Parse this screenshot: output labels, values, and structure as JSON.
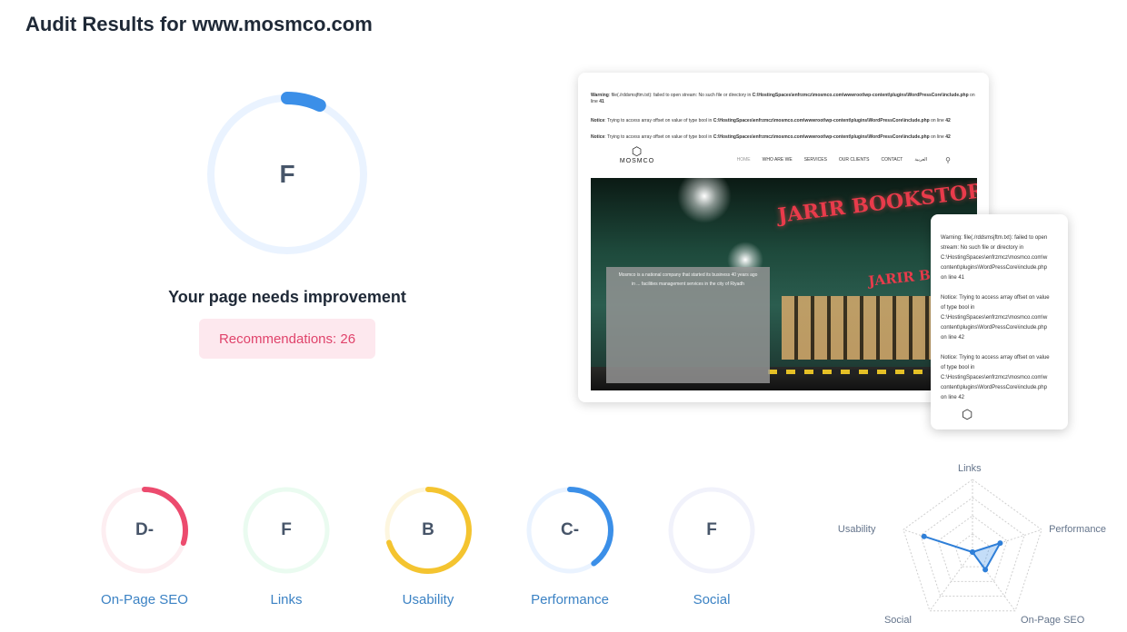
{
  "page": {
    "title": "Audit Results for www.mosmco.com"
  },
  "overall": {
    "grade": "F",
    "score_fraction": 0.07,
    "summary": "Your page needs improvement",
    "recommendations": "Recommendations: 26",
    "ring_color": "#3b8fe8",
    "ring_track": "#eaf3ff"
  },
  "desktop_preview": {
    "warnings": [
      {
        "label": "Warning",
        "text": ": file(./rddsmsjftm.txt): failed to open stream: No such file or directory in ",
        "path": "C:\\HostingSpaces\\enfrzmcz\\mosmco.com\\wwwroot\\wp-content\\plugins\\WordPressCore\\include.php",
        "suffix": " on line ",
        "line": "41"
      },
      {
        "label": "Notice",
        "text": ": Trying to access array offset on value of type bool in ",
        "path": "C:\\HostingSpaces\\enfrzmcz\\mosmco.com\\wwwroot\\wp-content\\plugins\\WordPressCore\\include.php",
        "suffix": " on line ",
        "line": "42"
      },
      {
        "label": "Notice",
        "text": ": Trying to access array offset on value of type bool in ",
        "path": "C:\\HostingSpaces\\enfrzmcz\\mosmco.com\\wwwroot\\wp-content\\plugins\\WordPressCore\\include.php",
        "suffix": " on line ",
        "line": "42"
      }
    ],
    "logo_text": "MOSMCO",
    "nav": [
      "HOME",
      "WHO ARE WE",
      "SERVICES",
      "OUR CLIENTS",
      "CONTACT",
      "العربية"
    ],
    "hero_sign": "JARIR BOOKSTORE",
    "hero_text": "Mosmco is a national company that started its business 40 years ago in ... facilities management services in the city of Riyadh"
  },
  "mobile_preview": {
    "lines": [
      "Warning: file(./rddsmsjftm.txt): failed to open",
      "stream: No such file or directory in",
      "C:\\HostingSpaces\\enfrzmcz\\mosmco.com\\w",
      "content\\plugins\\WordPressCore\\include.php",
      "on line 41",
      "",
      "Notice: Trying to access array offset on value",
      "of type bool in",
      "C:\\HostingSpaces\\enfrzmcz\\mosmco.com\\w",
      "content\\plugins\\WordPressCore\\include.php",
      "on line 42",
      "",
      "Notice: Trying to access array offset on value",
      "of type bool in",
      "C:\\HostingSpaces\\enfrzmcz\\mosmco.com\\w",
      "content\\plugins\\WordPressCore\\include.php",
      "on line 42"
    ]
  },
  "categories": [
    {
      "label": "On-Page SEO",
      "grade": "D-",
      "fraction": 0.3,
      "color": "#ec4b6e",
      "track": "#fdeef1"
    },
    {
      "label": "Links",
      "grade": "F",
      "fraction": 0.0,
      "color": "#4ade80",
      "track": "#eafbf0"
    },
    {
      "label": "Usability",
      "grade": "B",
      "fraction": 0.7,
      "color": "#f4c430",
      "track": "#fdf6df"
    },
    {
      "label": "Performance",
      "grade": "C-",
      "fraction": 0.4,
      "color": "#3b8fe8",
      "track": "#eaf3ff"
    },
    {
      "label": "Social",
      "grade": "F",
      "fraction": 0.0,
      "color": "#a5b4fc",
      "track": "#f1f2fb"
    }
  ],
  "radar": {
    "axes": [
      "Links",
      "Performance",
      "On-Page SEO",
      "Social",
      "Usability"
    ],
    "values": [
      0.0,
      0.4,
      0.3,
      0.0,
      0.7
    ],
    "color": "#2f7fd8"
  }
}
